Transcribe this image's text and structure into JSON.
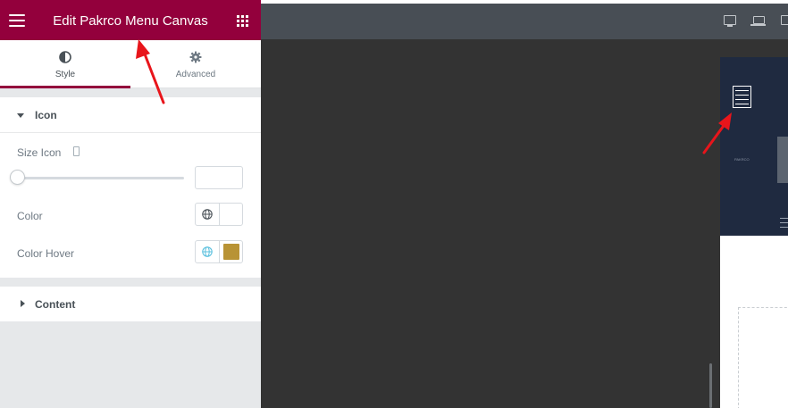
{
  "header": {
    "title": "Edit Pakrco Menu Canvas",
    "menu_icon": "hamburger-icon",
    "apps_icon": "grid-icon",
    "color": "#93003c"
  },
  "tabs": [
    {
      "label": "Style",
      "icon": "contrast-icon",
      "active": true
    },
    {
      "label": "Advanced",
      "icon": "gear-icon",
      "active": false
    }
  ],
  "sections": {
    "icon": {
      "title": "Icon",
      "expanded": true,
      "controls": {
        "size_icon": {
          "label": "Size Icon",
          "value": "",
          "responsive_icon": "mobile-icon"
        },
        "color": {
          "label": "Color",
          "swatch": "#ffffff"
        },
        "color_hover": {
          "label": "Color Hover",
          "swatch": "#b89335"
        }
      }
    },
    "content": {
      "title": "Content",
      "expanded": false
    }
  },
  "device_switcher": [
    "desktop-icon",
    "laptop-icon",
    "tablet-icon"
  ],
  "preview": {
    "header_color": "#1f2a40",
    "logo_text": "PAKRCO"
  },
  "annotation_color": "#e8151b"
}
